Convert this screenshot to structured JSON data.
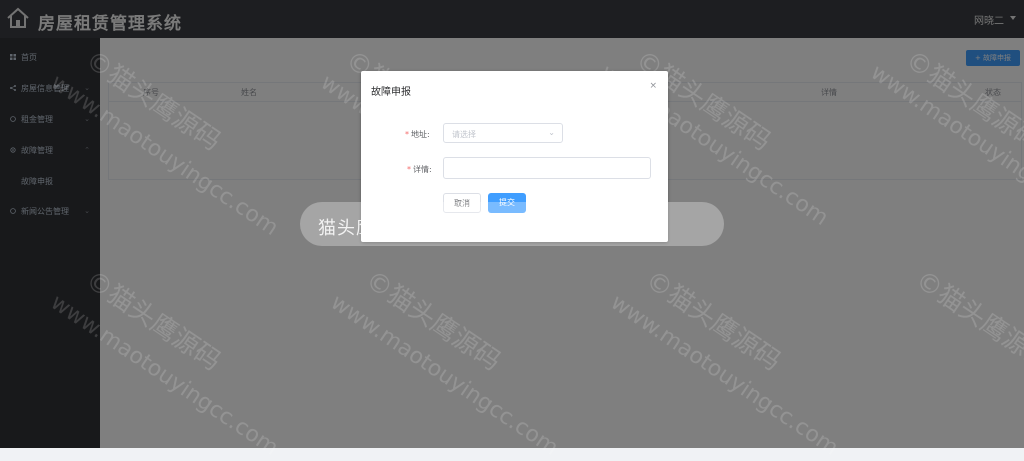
{
  "header": {
    "title": "房屋租赁管理系统",
    "user": "网晓二"
  },
  "sidebar": {
    "items": [
      {
        "label": "首页"
      },
      {
        "label": "房屋信息管理"
      },
      {
        "label": "租金管理"
      },
      {
        "label": "故障管理"
      },
      {
        "label": "故障申报"
      },
      {
        "label": "新闻公告管理"
      }
    ]
  },
  "main": {
    "add_button": "+ 故障申报",
    "table_headers": [
      "序号",
      "姓名",
      "详情",
      "状态"
    ]
  },
  "dialog": {
    "title": "故障申报",
    "close": "×",
    "address_label": "地址:",
    "address_placeholder": "请选择",
    "detail_label": "详情:",
    "cancel": "取消",
    "submit": "提交"
  },
  "watermark": {
    "line1": "©猫头鹰源码",
    "line2": "www.maotouyingcc.com",
    "band": "猫头鹰源码 maotouyingcc.com"
  }
}
